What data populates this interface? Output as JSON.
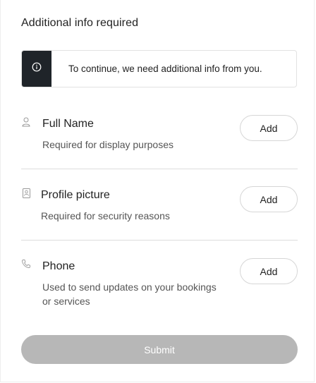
{
  "header": {
    "title": "Additional info required"
  },
  "notice": {
    "icon": "info-icon",
    "text": "To continue, we need additional info from you."
  },
  "fields": [
    {
      "icon": "user-icon",
      "title": "Full Name",
      "description": "Required for display purposes",
      "action_label": "Add"
    },
    {
      "icon": "id-card-icon",
      "title": "Profile picture",
      "description": "Required for security reasons",
      "action_label": "Add"
    },
    {
      "icon": "phone-icon",
      "title": "Phone",
      "description": "Used to send updates on your bookings or services",
      "action_label": "Add"
    }
  ],
  "footer": {
    "submit_label": "Submit",
    "submit_disabled": true
  },
  "colors": {
    "notice_icon_bg": "#1f2429",
    "submit_disabled_bg": "#b7b7b7",
    "divider": "#dddddd"
  }
}
